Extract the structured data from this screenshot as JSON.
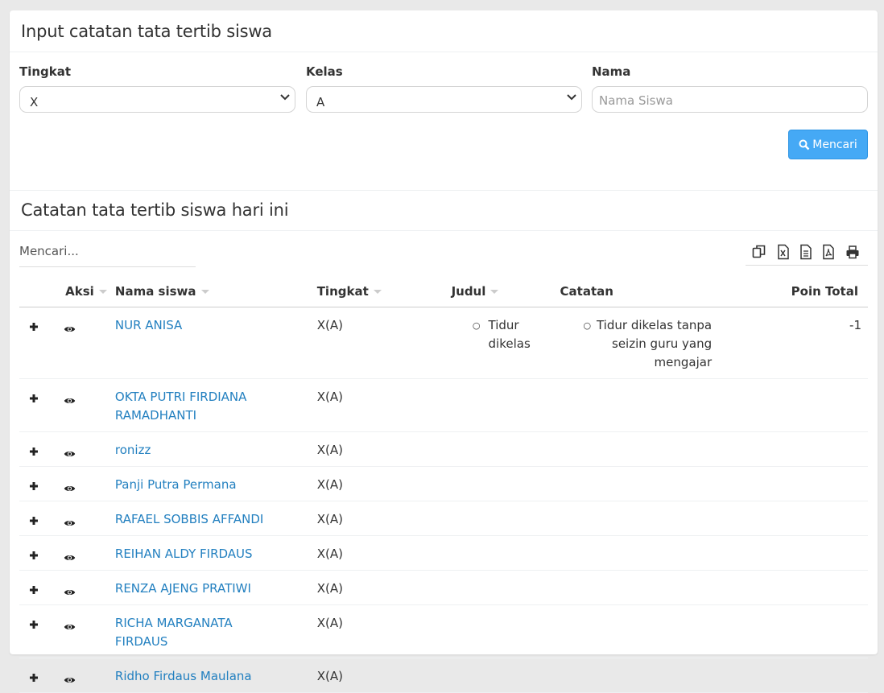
{
  "form": {
    "title": "Input catatan tata tertib siswa",
    "tingkat_label": "Tingkat",
    "tingkat_value": "X",
    "kelas_label": "Kelas",
    "kelas_value": "A",
    "nama_label": "Nama",
    "nama_placeholder": "Nama Siswa",
    "search_button": "Mencari"
  },
  "today": {
    "title": "Catatan tata tertib siswa hari ini",
    "search_placeholder": "Mencari...",
    "tools": [
      "copy-icon",
      "excel-icon",
      "csv-icon",
      "pdf-icon",
      "print-icon"
    ],
    "columns": {
      "aksi": "Aksi",
      "nama": "Nama siswa",
      "tingkat": "Tingkat",
      "judul": "Judul",
      "catatan": "Catatan",
      "poin": "Poin Total"
    },
    "rows": [
      {
        "nama": "NUR ANISA",
        "tingkat": "X(A)",
        "judul": "Tidur dikelas",
        "catatan": "Tidur dikelas tanpa seizin guru yang mengajar",
        "poin": "-1"
      },
      {
        "nama": "OKTA PUTRI FIRDIANA RAMADHANTI",
        "tingkat": "X(A)",
        "judul": "",
        "catatan": "",
        "poin": ""
      },
      {
        "nama": "ronizz",
        "tingkat": "X(A)",
        "judul": "",
        "catatan": "",
        "poin": ""
      },
      {
        "nama": "Panji Putra Permana",
        "tingkat": "X(A)",
        "judul": "",
        "catatan": "",
        "poin": ""
      },
      {
        "nama": "RAFAEL SOBBIS AFFANDI",
        "tingkat": "X(A)",
        "judul": "",
        "catatan": "",
        "poin": ""
      },
      {
        "nama": "REIHAN ALDY FIRDAUS",
        "tingkat": "X(A)",
        "judul": "",
        "catatan": "",
        "poin": ""
      },
      {
        "nama": "RENZA AJENG PRATIWI",
        "tingkat": "X(A)",
        "judul": "",
        "catatan": "",
        "poin": ""
      },
      {
        "nama": "RICHA MARGANATA FIRDAUS",
        "tingkat": "X(A)",
        "judul": "",
        "catatan": "",
        "poin": ""
      },
      {
        "nama": "Ridho Firdaus Maulana",
        "tingkat": "X(A)",
        "judul": "",
        "catatan": "",
        "poin": ""
      }
    ]
  }
}
